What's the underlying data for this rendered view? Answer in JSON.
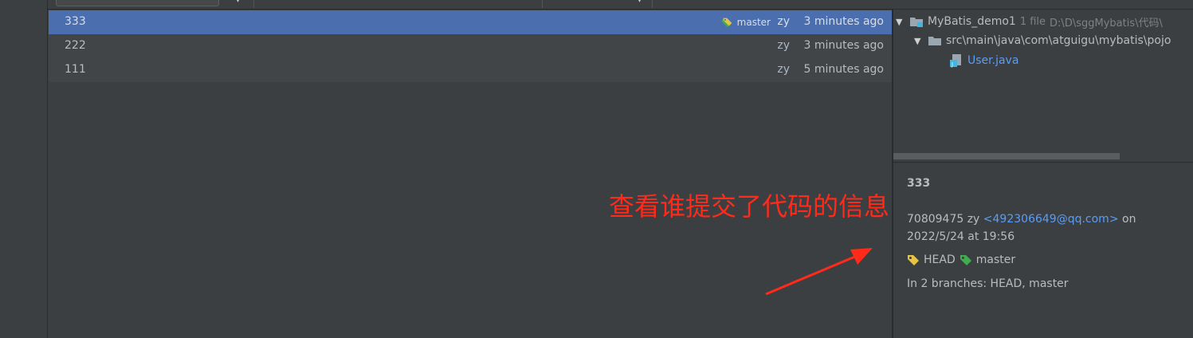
{
  "log": {
    "commits": [
      {
        "message": "333",
        "refs": [
          "master"
        ],
        "author": "zy",
        "date": "3 minutes ago"
      },
      {
        "message": "222",
        "author": "zy",
        "date": "3 minutes ago"
      },
      {
        "message": "111",
        "author": "zy",
        "date": "5 minutes ago"
      }
    ]
  },
  "changes_tree": {
    "root": {
      "label": "MyBatis_demo1",
      "count": "1 file",
      "path": "D:\\D\\sggMybatis\\代码\\"
    },
    "folder": {
      "label": "src\\main\\java\\com\\atguigu\\mybatis\\pojo"
    },
    "file": {
      "label": "User.java"
    }
  },
  "details": {
    "title": "333",
    "hash_author": "70809475 zy",
    "email": "<492306649@qq.com>",
    "on": "on",
    "datetime": "2022/5/24 at 19:56",
    "ref_head": "HEAD",
    "ref_master": "master",
    "branches": "In 2 branches: HEAD, master"
  },
  "annotation": {
    "text": "查看谁提交了代码的信息",
    "color": "#ff2a1a"
  },
  "colors": {
    "selection": "#4b6eaf",
    "graph": "#8faa6a",
    "tag_yellow": "#e8c342",
    "tag_green": "#3fae4f"
  },
  "icons": {
    "root": "module-folder-icon",
    "folder": "folder-icon",
    "file": "java-class-file-icon",
    "ref": "tag-icon"
  }
}
